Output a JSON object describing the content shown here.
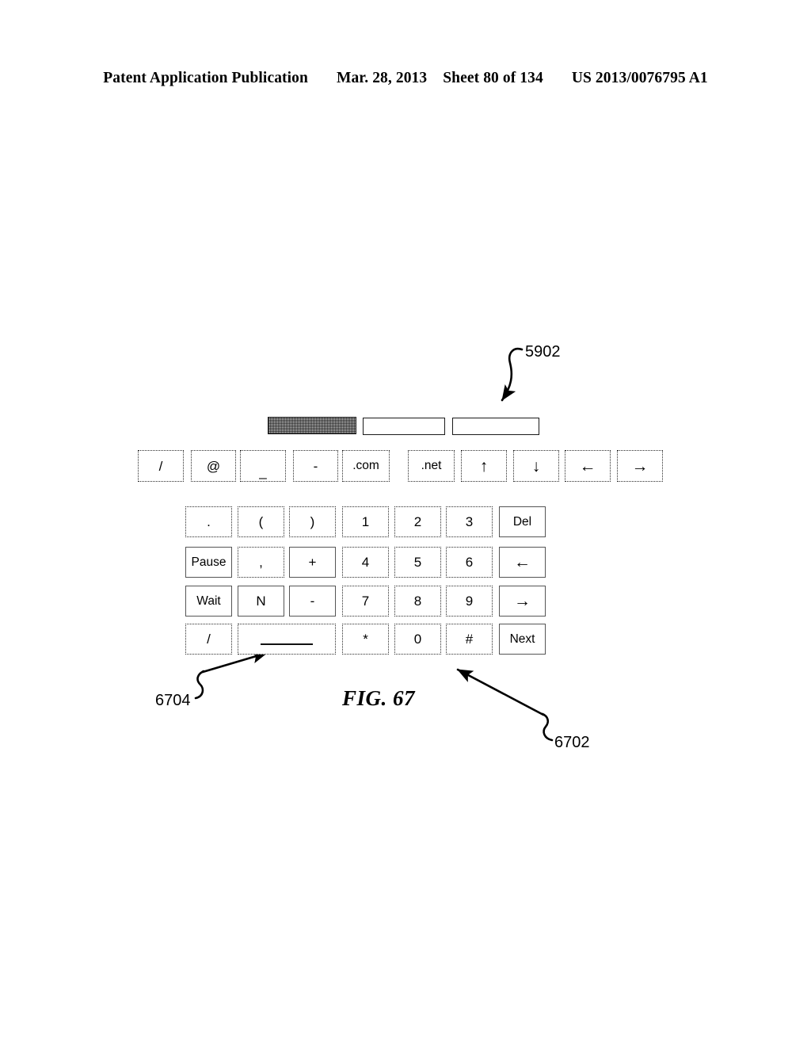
{
  "header": {
    "publication": "Patent Application Publication",
    "date": "Mar. 28, 2013",
    "sheet": "Sheet 80 of 134",
    "number": "US 2013/0076795 A1"
  },
  "figure": {
    "caption": "FIG. 67",
    "reference_numerals": [
      {
        "id": "5902",
        "label": "5902",
        "points_to": "display-bars"
      },
      {
        "id": "6704",
        "label": "6704",
        "points_to": "space-key"
      },
      {
        "id": "6702",
        "label": "6702",
        "points_to": "numeric-keypad"
      }
    ],
    "display_bars": [
      {
        "name": "bar-1",
        "filled": true
      },
      {
        "name": "bar-2",
        "filled": false
      },
      {
        "name": "bar-3",
        "filled": false
      }
    ],
    "symbol_row": [
      {
        "key": "slash",
        "label": "/"
      },
      {
        "key": "at",
        "label": "@"
      },
      {
        "key": "underscore",
        "label": "_"
      },
      {
        "key": "hyphen",
        "label": "-"
      },
      {
        "key": "dotcom",
        "label": ".com"
      },
      {
        "key": "dotnet",
        "label": ".net"
      },
      {
        "key": "arrow-up",
        "label": "↑"
      },
      {
        "key": "arrow-down",
        "label": "↓"
      },
      {
        "key": "arrow-left",
        "label": "←"
      },
      {
        "key": "arrow-right",
        "label": "→"
      }
    ],
    "keypad_rows": [
      [
        {
          "key": "period",
          "label": "."
        },
        {
          "key": "paren-open",
          "label": "("
        },
        {
          "key": "paren-close",
          "label": ")"
        },
        {
          "key": "digit-1",
          "label": "1"
        },
        {
          "key": "digit-2",
          "label": "2"
        },
        {
          "key": "digit-3",
          "label": "3"
        },
        {
          "key": "delete",
          "label": "Del"
        }
      ],
      [
        {
          "key": "pause",
          "label": "Pause"
        },
        {
          "key": "comma",
          "label": ","
        },
        {
          "key": "plus",
          "label": "+"
        },
        {
          "key": "digit-4",
          "label": "4"
        },
        {
          "key": "digit-5",
          "label": "5"
        },
        {
          "key": "digit-6",
          "label": "6"
        },
        {
          "key": "arrow-left",
          "label": "←"
        }
      ],
      [
        {
          "key": "wait",
          "label": "Wait"
        },
        {
          "key": "letter-n",
          "label": "N"
        },
        {
          "key": "hyphen",
          "label": "-"
        },
        {
          "key": "digit-7",
          "label": "7"
        },
        {
          "key": "digit-8",
          "label": "8"
        },
        {
          "key": "digit-9",
          "label": "9"
        },
        {
          "key": "arrow-right",
          "label": "→"
        }
      ],
      [
        {
          "key": "slash",
          "label": "/"
        },
        {
          "key": "space",
          "label": ""
        },
        {
          "key": "asterisk",
          "label": "*"
        },
        {
          "key": "digit-0",
          "label": "0"
        },
        {
          "key": "pound",
          "label": "#"
        },
        {
          "key": "next",
          "label": "Next"
        }
      ]
    ]
  },
  "colors": {
    "ink": "#000000",
    "key_border": "#2b2b2b",
    "bar_border": "#1a1a1a",
    "bar_fill": "#c8c8c8",
    "page_background": "#ffffff"
  }
}
